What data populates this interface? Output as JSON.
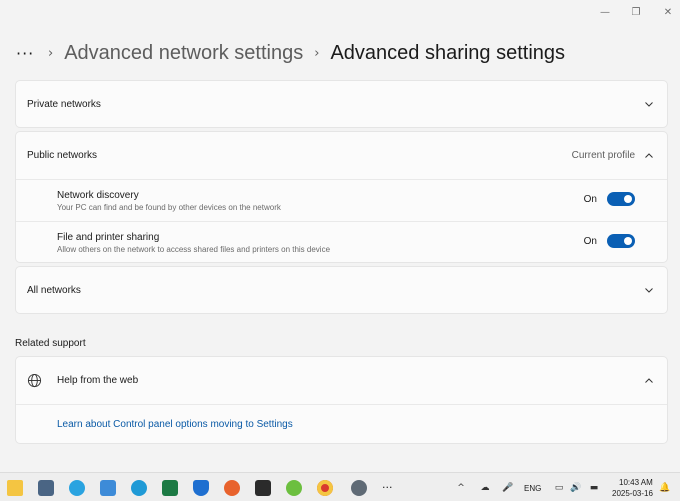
{
  "window": {
    "minimize_glyph": "—",
    "maximize_glyph": "❐",
    "close_glyph": "✕"
  },
  "breadcrumb": {
    "more": "···",
    "parent": "Advanced network settings",
    "current": "Advanced sharing settings"
  },
  "private_networks": {
    "label": "Private networks"
  },
  "public_networks": {
    "label": "Public networks",
    "status": "Current profile",
    "settings": [
      {
        "title": "Network discovery",
        "description": "Your PC can find and be found by other devices on the network",
        "state": "On"
      },
      {
        "title": "File and printer sharing",
        "description": "Allow others on the network to access shared files and printers on this device",
        "state": "On"
      }
    ]
  },
  "all_networks": {
    "label": "All networks"
  },
  "related_support": {
    "title": "Related support",
    "help_label": "Help from the web",
    "link": "Learn about Control panel options moving to Settings"
  },
  "taskbar": {
    "apps": [
      "file-explorer-icon",
      "calculator-icon",
      "telegram-icon",
      "snipping-tool-icon",
      "edge-icon",
      "excel-icon",
      "defender-icon",
      "firefox-icon",
      "terminal-icon",
      "utorrent-icon",
      "chrome-icon",
      "settings-icon",
      "more-apps-icon"
    ],
    "more_apps_glyph": "···",
    "language": "ENG",
    "time": "10:43 AM",
    "date": "2025-03-16"
  },
  "colors": {
    "accent": "#0a5fb4",
    "link": "#0a5aa6",
    "background": "#f3f3f3",
    "card": "#fbfbfb"
  }
}
